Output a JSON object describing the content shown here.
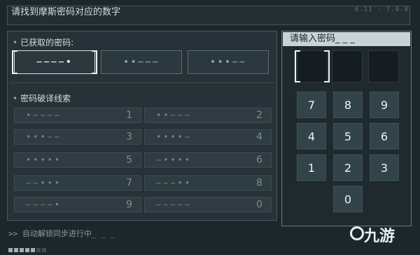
{
  "header": {
    "title": "请找到摩斯密码对应的数字",
    "meta": "6.11 · 7.0.8"
  },
  "acquired": {
    "label": "已获取的密码:",
    "codes": [
      "−−−−•",
      "••−−−",
      "•••−−"
    ]
  },
  "clues": {
    "label": "密码破译线索",
    "items": [
      {
        "code": "•−−−−",
        "num": "1"
      },
      {
        "code": "••−−−",
        "num": "2"
      },
      {
        "code": "•••−−",
        "num": "3"
      },
      {
        "code": "••••−",
        "num": "4"
      },
      {
        "code": "•••••",
        "num": "5"
      },
      {
        "code": "−••••",
        "num": "6"
      },
      {
        "code": "−−•••",
        "num": "7"
      },
      {
        "code": "−−−••",
        "num": "8"
      },
      {
        "code": "−−−−•",
        "num": "9"
      },
      {
        "code": "−−−−−",
        "num": "0"
      }
    ]
  },
  "status": {
    "text": ">> 自动解锁同步进行中_ _ _"
  },
  "password": {
    "header": "请输入密码_ _ _"
  },
  "keypad": {
    "keys": [
      "7",
      "8",
      "9",
      "4",
      "5",
      "6",
      "1",
      "2",
      "3",
      "0"
    ]
  },
  "watermark": {
    "text": "九游"
  },
  "colors": {
    "background": "#1c272c",
    "panel": "#263237",
    "key": "#33434a",
    "header_bar": "#c9d2d4"
  }
}
